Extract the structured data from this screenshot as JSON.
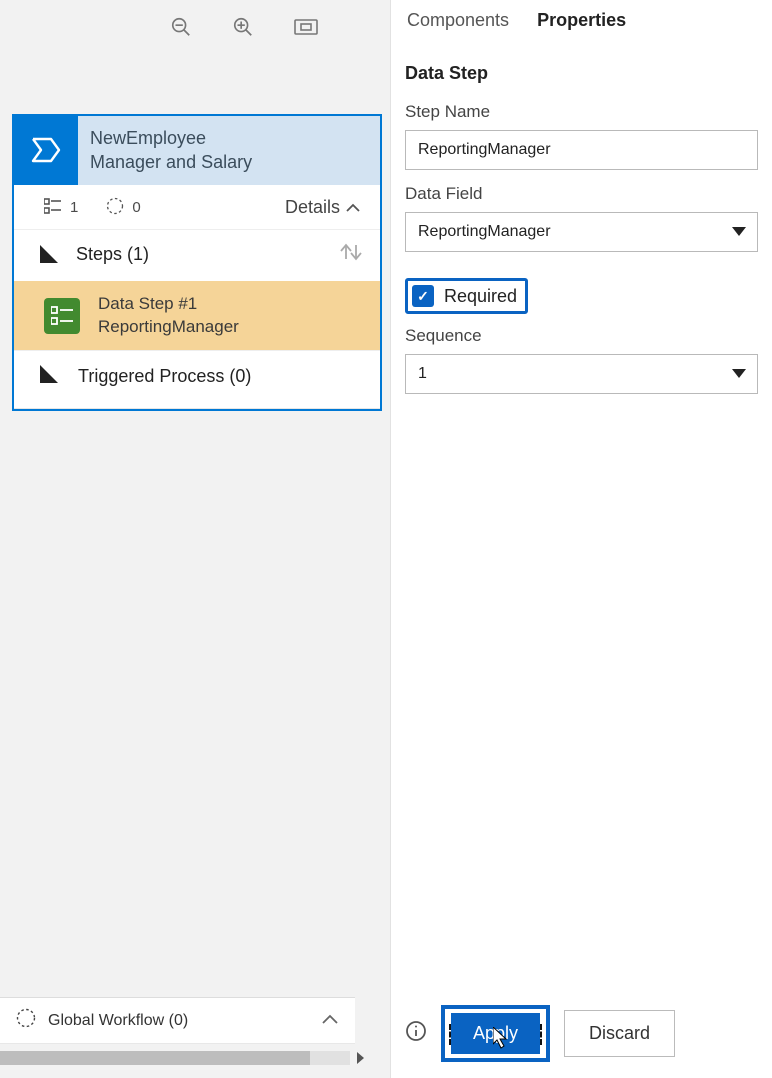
{
  "tabs": {
    "components": "Components",
    "properties": "Properties",
    "active": "properties"
  },
  "section_heading": "Data Step",
  "stepName": {
    "label": "Step Name",
    "value": "ReportingManager"
  },
  "dataField": {
    "label": "Data Field",
    "value": "ReportingManager"
  },
  "required": {
    "label": "Required",
    "checked": true
  },
  "sequence": {
    "label": "Sequence",
    "value": "1"
  },
  "buttons": {
    "apply": "Apply",
    "discard": "Discard"
  },
  "stage": {
    "title_line1": "NewEmployee",
    "title_line2": "Manager and Salary",
    "meta_count1": "1",
    "meta_count2": "0",
    "details_label": "Details",
    "steps_label": "Steps (1)",
    "triggered_label": "Triggered Process (0)",
    "dataStep": {
      "line1": "Data Step #1",
      "line2": "ReportingManager"
    }
  },
  "globalWorkflow": {
    "label": "Global Workflow (0)"
  }
}
